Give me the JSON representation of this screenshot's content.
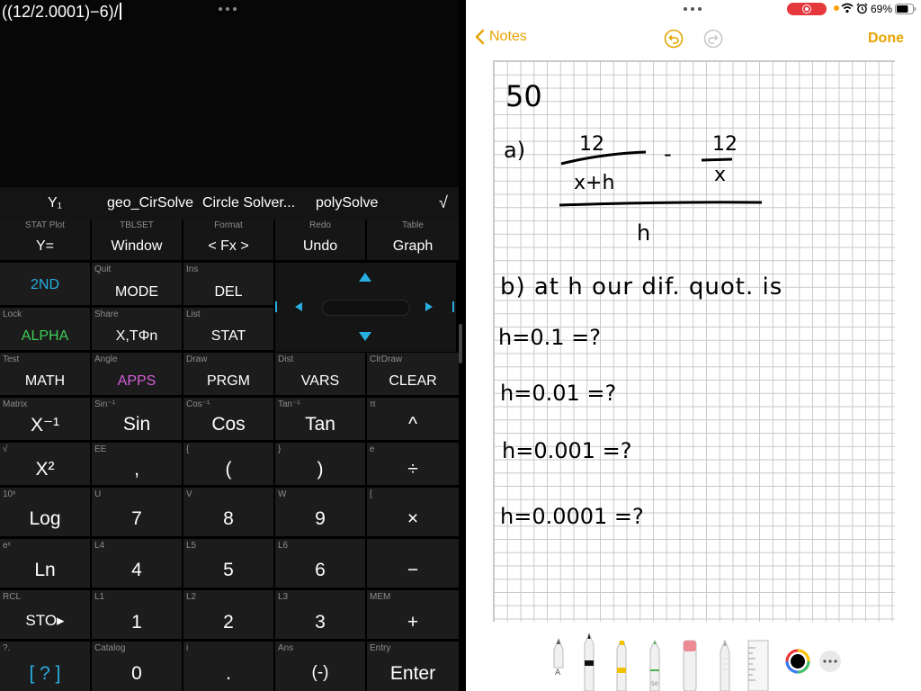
{
  "calculator": {
    "expression": "((12/2.0001)−6)/",
    "catalog": [
      "Y₁",
      "geo_CirSolve",
      "Circle Solver...",
      "polySolve",
      "√"
    ],
    "row_top": [
      {
        "sec": "STAT Plot",
        "main": "Y="
      },
      {
        "sec": "TBLSET",
        "main": "Window"
      },
      {
        "sec": "Format",
        "main": "< Fx >"
      },
      {
        "sec": "Redo",
        "main": "Undo"
      },
      {
        "sec": "Table",
        "main": "Graph"
      }
    ],
    "row_2": [
      {
        "sec": "",
        "main": "2ND"
      },
      {
        "sec": "Quit",
        "main": "MODE"
      },
      {
        "sec": "Ins",
        "main": "DEL"
      }
    ],
    "row_3": [
      {
        "sec": "Lock",
        "main": "ALPHA"
      },
      {
        "sec": "Share",
        "main": "X,TΦn"
      },
      {
        "sec": "List",
        "main": "STAT"
      }
    ],
    "row_4": [
      {
        "sec": "Test",
        "main": "MATH"
      },
      {
        "sec": "Angle",
        "main": "APPS"
      },
      {
        "sec": "Draw",
        "main": "PRGM"
      },
      {
        "sec": "Dist",
        "main": "VARS"
      },
      {
        "sec": "ClrDraw",
        "main": "CLEAR"
      }
    ],
    "row_5": [
      {
        "sec": "Matrix",
        "main": "X⁻¹"
      },
      {
        "sec": "Sin⁻¹",
        "main": "Sin"
      },
      {
        "sec": "Cos⁻¹",
        "main": "Cos"
      },
      {
        "sec": "Tan⁻¹",
        "main": "Tan"
      },
      {
        "sec": "π",
        "main": "^"
      }
    ],
    "row_6": [
      {
        "sec": "√",
        "main": "X²"
      },
      {
        "sec": "EE",
        "main": ","
      },
      {
        "sec": "{",
        "main": "("
      },
      {
        "sec": "}",
        "main": ")"
      },
      {
        "sec": "e",
        "main": "÷"
      }
    ],
    "row_7": [
      {
        "sec": "10ˣ",
        "main": "Log"
      },
      {
        "sec": "U",
        "main": "7"
      },
      {
        "sec": "V",
        "main": "8"
      },
      {
        "sec": "W",
        "main": "9"
      },
      {
        "sec": "[",
        "main": "×"
      }
    ],
    "row_8": [
      {
        "sec": "eˣ",
        "main": "Ln"
      },
      {
        "sec": "L4",
        "main": "4"
      },
      {
        "sec": "L5",
        "main": "5"
      },
      {
        "sec": "L6",
        "main": "6"
      },
      {
        "sec": "",
        "main": "−"
      }
    ],
    "row_9": [
      {
        "sec": "RCL",
        "main": "STO▸"
      },
      {
        "sec": "L1",
        "main": "1"
      },
      {
        "sec": "L2",
        "main": "2"
      },
      {
        "sec": "L3",
        "main": "3"
      },
      {
        "sec": "MEM",
        "main": "+"
      }
    ],
    "row_10": [
      {
        "sec": "?.",
        "main": "[ ? ]"
      },
      {
        "sec": "Catalog",
        "main": "0"
      },
      {
        "sec": "i",
        "main": "."
      },
      {
        "sec": "Ans",
        "main": "(-)"
      },
      {
        "sec": "Entry",
        "main": "Enter"
      }
    ]
  },
  "notes": {
    "back_label": "Notes",
    "done_label": "Done",
    "battery": "69%",
    "handwriting": {
      "problem_number": "50",
      "part_a_label": "a)",
      "num_left_top": "12",
      "num_left_bottom": "x+h",
      "minus": "-",
      "num_right_top": "12",
      "num_right_bottom": "x",
      "denominator": "h",
      "part_b": "b) at h our dif. quot. is",
      "rows": [
        "h=0.1 =?",
        "h=0.01 =?",
        "h=0.001 =?",
        "h=0.0001 =?"
      ]
    },
    "tools": [
      "pen",
      "marker",
      "highlighter",
      "monoline-pen",
      "eraser",
      "pencil",
      "ruler",
      "color-picker",
      "more"
    ],
    "accent_color": "#e6a400"
  }
}
